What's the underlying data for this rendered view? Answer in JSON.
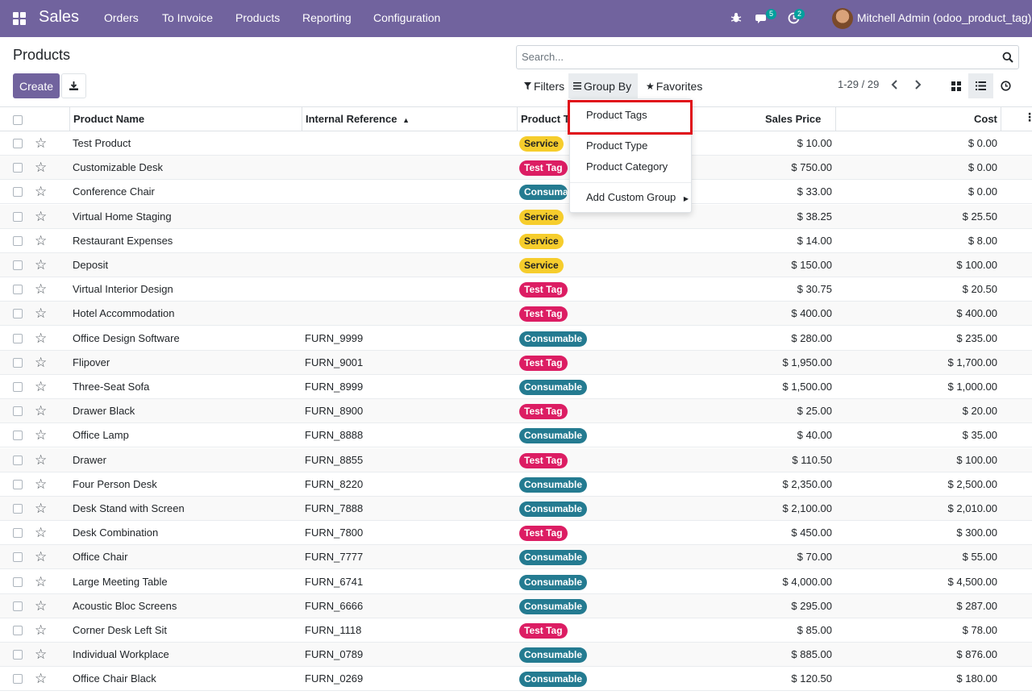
{
  "navbar": {
    "app_name": "Sales",
    "menu": [
      "Orders",
      "To Invoice",
      "Products",
      "Reporting",
      "Configuration"
    ],
    "messages_count": "5",
    "activities_count": "2",
    "user": "Mitchell Admin (odoo_product_tag)",
    "icons": [
      "apps-grid-icon",
      "bug-icon",
      "chat-icon",
      "clock-icon"
    ]
  },
  "control_panel": {
    "title": "Products",
    "create_label": "Create",
    "search_placeholder": "Search...",
    "filters_label": "Filters",
    "groupby_label": "Group By",
    "favorites_label": "Favorites",
    "pager": "1-29 / 29"
  },
  "groupby_menu": {
    "items": [
      "Product Tags",
      "Product Type",
      "Product Category"
    ],
    "custom_label": "Add Custom Group"
  },
  "table": {
    "headers": {
      "name": "Product Name",
      "ref": "Internal Reference",
      "tags": "Product Tags",
      "price": "Sales Price",
      "cost": "Cost"
    },
    "rows": [
      {
        "name": "Test Product",
        "ref": "",
        "tag": "Service",
        "price": "$ 10.00",
        "cost": "$ 0.00"
      },
      {
        "name": "Customizable Desk",
        "ref": "",
        "tag": "Test Tag",
        "price": "$ 750.00",
        "cost": "$ 0.00"
      },
      {
        "name": "Conference Chair",
        "ref": "",
        "tag": "Consumable",
        "price": "$ 33.00",
        "cost": "$ 0.00"
      },
      {
        "name": "Virtual Home Staging",
        "ref": "",
        "tag": "Service",
        "price": "$ 38.25",
        "cost": "$ 25.50"
      },
      {
        "name": "Restaurant Expenses",
        "ref": "",
        "tag": "Service",
        "price": "$ 14.00",
        "cost": "$ 8.00"
      },
      {
        "name": "Deposit",
        "ref": "",
        "tag": "Service",
        "price": "$ 150.00",
        "cost": "$ 100.00"
      },
      {
        "name": "Virtual Interior Design",
        "ref": "",
        "tag": "Test Tag",
        "price": "$ 30.75",
        "cost": "$ 20.50"
      },
      {
        "name": "Hotel Accommodation",
        "ref": "",
        "tag": "Test Tag",
        "price": "$ 400.00",
        "cost": "$ 400.00"
      },
      {
        "name": "Office Design Software",
        "ref": "FURN_9999",
        "tag": "Consumable",
        "price": "$ 280.00",
        "cost": "$ 235.00"
      },
      {
        "name": "Flipover",
        "ref": "FURN_9001",
        "tag": "Test Tag",
        "price": "$ 1,950.00",
        "cost": "$ 1,700.00"
      },
      {
        "name": "Three-Seat Sofa",
        "ref": "FURN_8999",
        "tag": "Consumable",
        "price": "$ 1,500.00",
        "cost": "$ 1,000.00"
      },
      {
        "name": "Drawer Black",
        "ref": "FURN_8900",
        "tag": "Test Tag",
        "price": "$ 25.00",
        "cost": "$ 20.00"
      },
      {
        "name": "Office Lamp",
        "ref": "FURN_8888",
        "tag": "Consumable",
        "price": "$ 40.00",
        "cost": "$ 35.00"
      },
      {
        "name": "Drawer",
        "ref": "FURN_8855",
        "tag": "Test Tag",
        "price": "$ 110.50",
        "cost": "$ 100.00"
      },
      {
        "name": "Four Person Desk",
        "ref": "FURN_8220",
        "tag": "Consumable",
        "price": "$ 2,350.00",
        "cost": "$ 2,500.00"
      },
      {
        "name": "Desk Stand with Screen",
        "ref": "FURN_7888",
        "tag": "Consumable",
        "price": "$ 2,100.00",
        "cost": "$ 2,010.00"
      },
      {
        "name": "Desk Combination",
        "ref": "FURN_7800",
        "tag": "Test Tag",
        "price": "$ 450.00",
        "cost": "$ 300.00"
      },
      {
        "name": "Office Chair",
        "ref": "FURN_7777",
        "tag": "Consumable",
        "price": "$ 70.00",
        "cost": "$ 55.00"
      },
      {
        "name": "Large Meeting Table",
        "ref": "FURN_6741",
        "tag": "Consumable",
        "price": "$ 4,000.00",
        "cost": "$ 4,500.00"
      },
      {
        "name": "Acoustic Bloc Screens",
        "ref": "FURN_6666",
        "tag": "Consumable",
        "price": "$ 295.00",
        "cost": "$ 287.00"
      },
      {
        "name": "Corner Desk Left Sit",
        "ref": "FURN_1118",
        "tag": "Test Tag",
        "price": "$ 85.00",
        "cost": "$ 78.00"
      },
      {
        "name": "Individual Workplace",
        "ref": "FURN_0789",
        "tag": "Consumable",
        "price": "$ 885.00",
        "cost": "$ 876.00"
      },
      {
        "name": "Office Chair Black",
        "ref": "FURN_0269",
        "tag": "Consumable",
        "price": "$ 120.50",
        "cost": "$ 180.00"
      }
    ]
  },
  "colors": {
    "brand": "#71639e",
    "tag_service": "#f6cd2c",
    "tag_test": "#dc1d63",
    "tag_consumable": "#247b91",
    "highlight": "#e0101a"
  }
}
